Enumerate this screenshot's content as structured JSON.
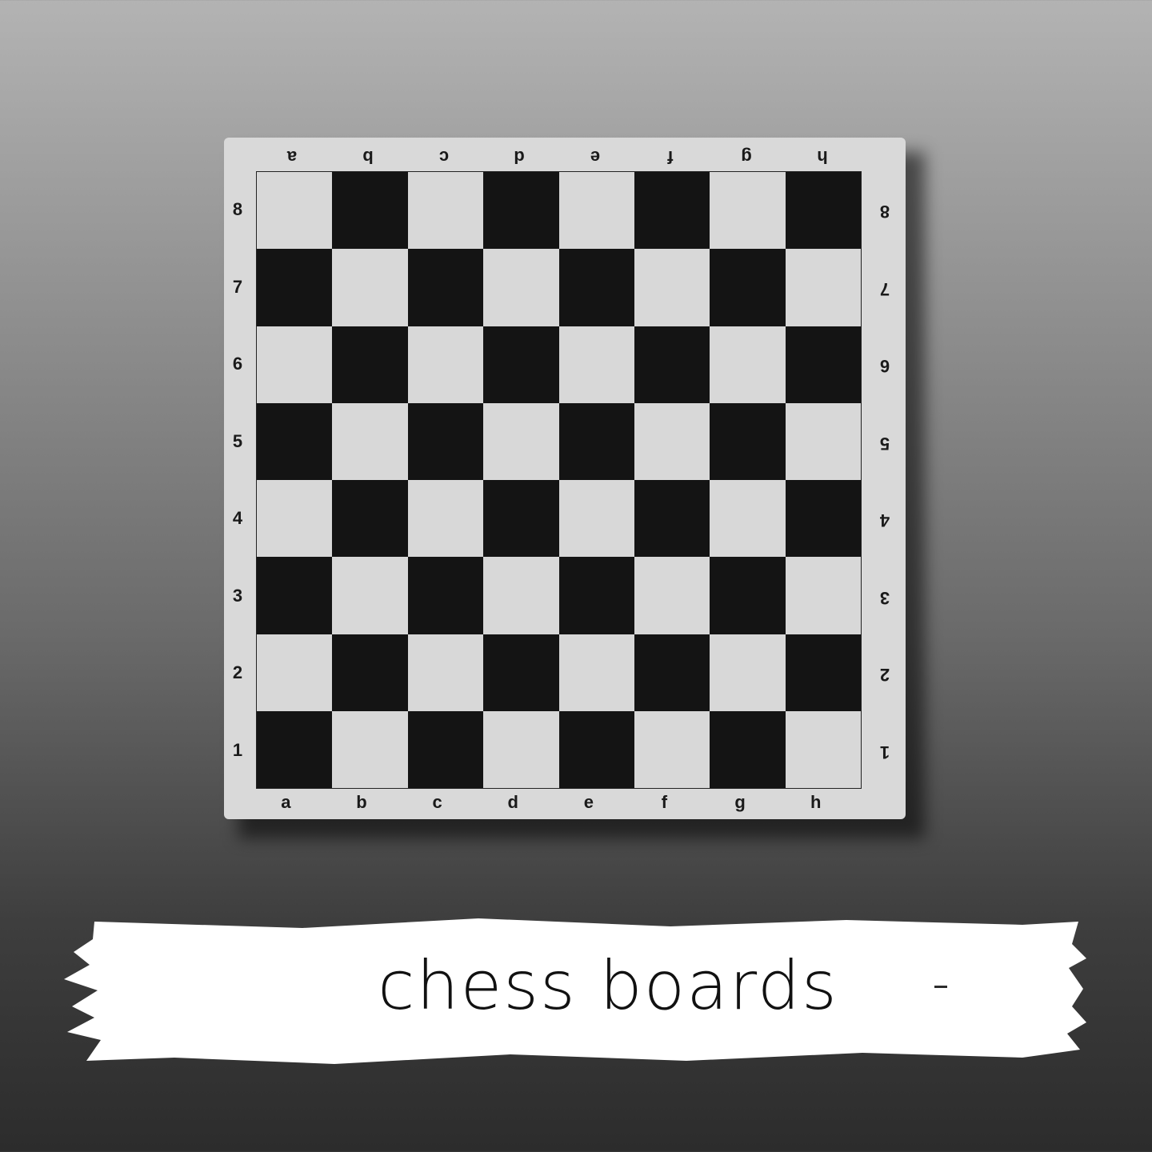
{
  "board": {
    "files": [
      "a",
      "b",
      "c",
      "d",
      "e",
      "f",
      "g",
      "h"
    ],
    "ranks": [
      "8",
      "7",
      "6",
      "5",
      "4",
      "3",
      "2",
      "1"
    ]
  },
  "caption": "chess boards",
  "colors": {
    "dark_square": "#141414",
    "light_square": "#d8d8d8",
    "board_frame": "#d9d9d9",
    "banner": "#ffffff"
  }
}
